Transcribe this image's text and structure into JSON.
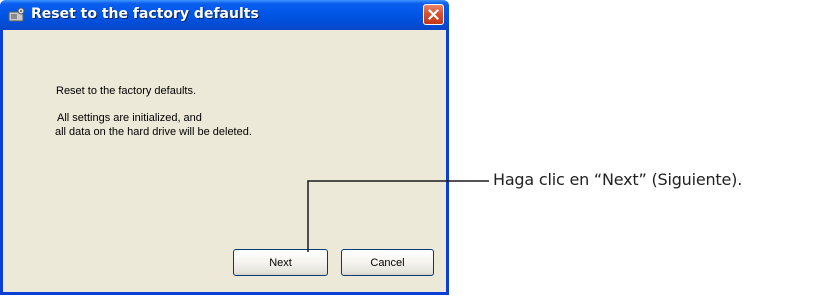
{
  "window": {
    "title": "Reset to the factory defaults",
    "title_icon": "gear-icon",
    "close_icon": "close-icon"
  },
  "body": {
    "heading": "Reset to the factory defaults.",
    "line1": "All settings are initialized, and",
    "line2": " all data on the hard drive will be deleted."
  },
  "buttons": {
    "next_label": "Next",
    "cancel_label": "Cancel"
  },
  "annotation": {
    "text": "Haga clic en “Next” (Siguiente)."
  },
  "colors": {
    "titlebar": "#0056e6",
    "dialog_bg": "#ece9d8",
    "close_button": "#d9502f"
  }
}
